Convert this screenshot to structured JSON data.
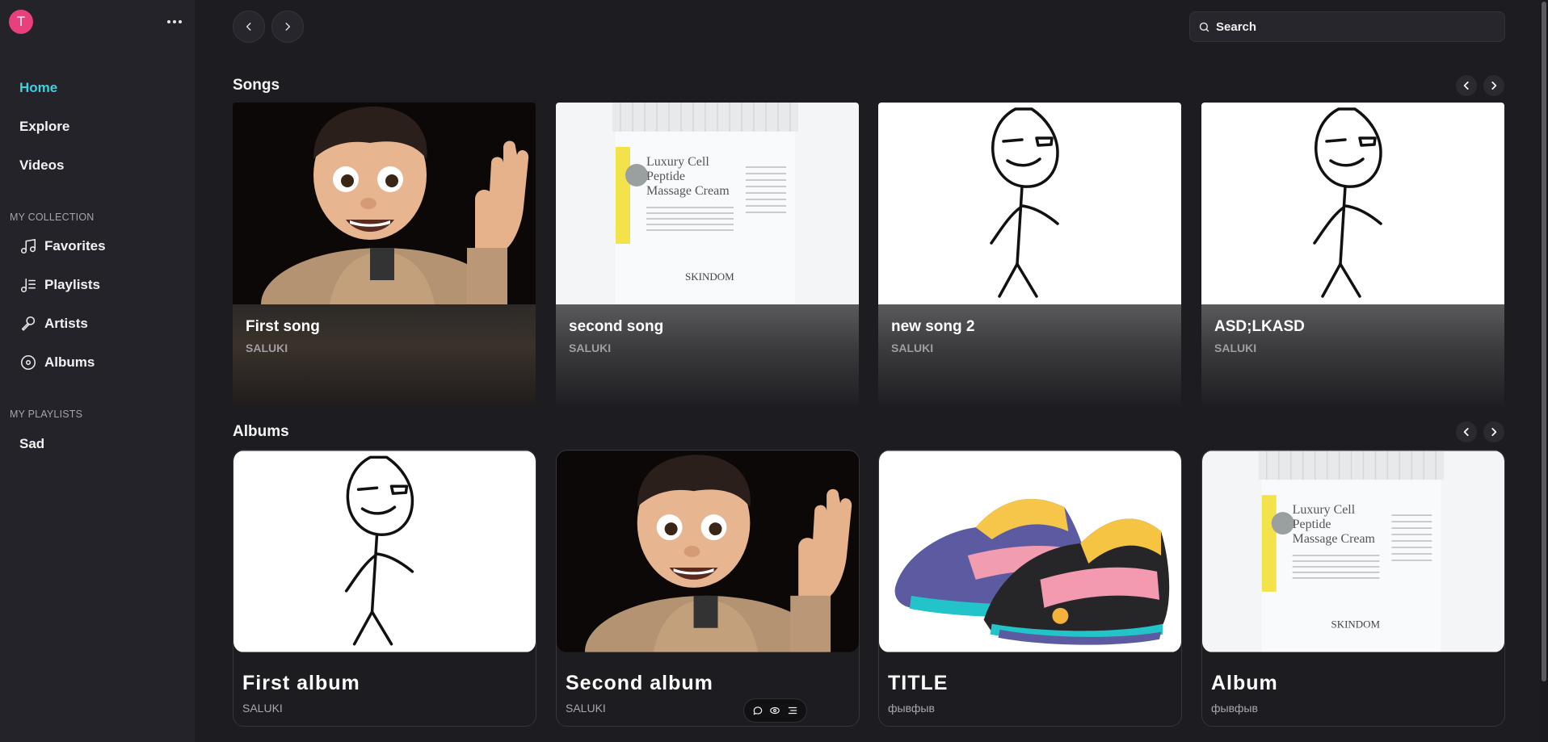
{
  "sidebar": {
    "avatar_letter": "T",
    "nav": {
      "home": "Home",
      "explore": "Explore",
      "videos": "Videos"
    },
    "collection_label": "MY COLLECTION",
    "collection": {
      "favorites": "Favorites",
      "playlists": "Playlists",
      "artists": "Artists",
      "albums": "Albums"
    },
    "playlists_label": "MY PLAYLISTS",
    "playlists": [
      "Sad"
    ]
  },
  "search": {
    "placeholder": "Search"
  },
  "songs": {
    "title": "Songs",
    "items": [
      {
        "title": "First song",
        "artist": "SALUKI",
        "art": "waving-avatar"
      },
      {
        "title": "second song",
        "artist": "SALUKI",
        "art": "cream-jar"
      },
      {
        "title": "new song 2",
        "artist": "SALUKI",
        "art": "stick-figure"
      },
      {
        "title": "ASD;LKASD",
        "artist": "SALUKI",
        "art": "stick-figure"
      }
    ]
  },
  "albums": {
    "title": "Albums",
    "items": [
      {
        "title": "First album",
        "artist": "SALUKI",
        "art": "stick-figure"
      },
      {
        "title": "Second album",
        "artist": "SALUKI",
        "art": "waving-avatar"
      },
      {
        "title": "TITLE",
        "artist": "фывфыв",
        "art": "sneakers"
      },
      {
        "title": "Album",
        "artist": "фывфыв",
        "art": "cream-jar"
      }
    ]
  },
  "colors": {
    "accent": "#3ad1e0",
    "avatar": "#e8407a",
    "background": "#1c1c21",
    "sidebar": "#232329"
  },
  "icons": [
    "more-icon",
    "chevron-left-icon",
    "chevron-right-icon",
    "search-icon",
    "music-note-icon",
    "playlist-icon",
    "microphone-icon",
    "disc-icon",
    "comment-icon",
    "eye-icon",
    "menu-icon"
  ]
}
